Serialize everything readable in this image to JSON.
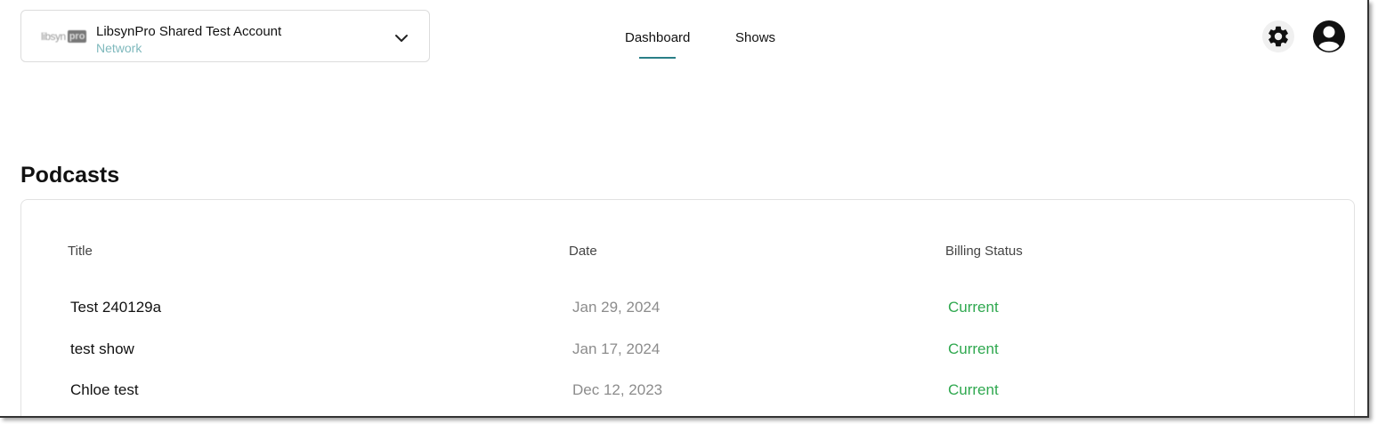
{
  "account": {
    "logo_text": "libsyn",
    "logo_badge": "pro",
    "name": "LibsynPro Shared Test Account",
    "type": "Network"
  },
  "nav": {
    "tabs": [
      {
        "label": "Dashboard",
        "active": true
      },
      {
        "label": "Shows",
        "active": false
      }
    ]
  },
  "header_icons": [
    "gear-icon",
    "user-avatar-icon"
  ],
  "podcasts": {
    "title": "Podcasts",
    "columns": [
      "Title",
      "Date",
      "Billing Status"
    ],
    "rows": [
      {
        "title": "Test 240129a",
        "date": "Jan 29, 2024",
        "status": "Current"
      },
      {
        "title": "test show",
        "date": "Jan 17, 2024",
        "status": "Current"
      },
      {
        "title": "Chloe test",
        "date": "Dec 12, 2023",
        "status": "Current"
      }
    ]
  },
  "colors": {
    "accent": "#2a7f87",
    "network_label": "#7fb9bd",
    "status_current": "#2fa84f",
    "date_text": "#8c8c8c"
  }
}
